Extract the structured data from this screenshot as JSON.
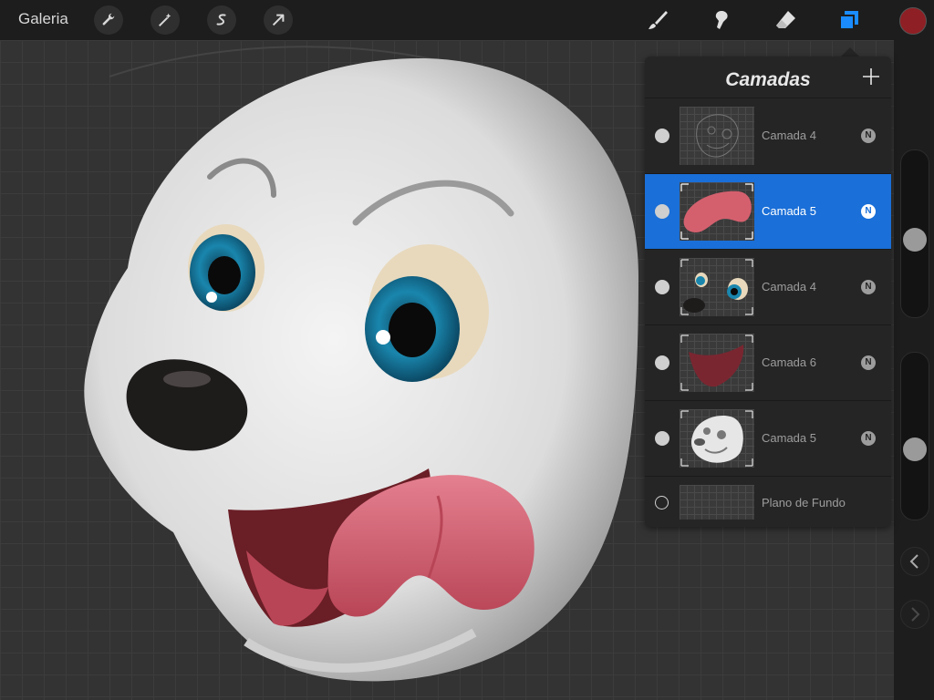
{
  "topbar": {
    "gallery_label": "Galeria",
    "left_tools": [
      "wrench-icon",
      "magic-wand-icon",
      "selection-icon",
      "transform-arrow-icon"
    ],
    "right_tools": [
      "brush-icon",
      "smudge-icon",
      "eraser-icon",
      "layers-icon"
    ],
    "active_tool": "layers-icon",
    "current_color": "#8e1f24"
  },
  "layers_panel": {
    "title": "Camadas",
    "add_icon": "plus-icon",
    "layers": [
      {
        "name": "Camada 4",
        "blend": "N",
        "visible": true,
        "selected": false,
        "thumb": "sketch"
      },
      {
        "name": "Camada 5",
        "blend": "N",
        "visible": true,
        "selected": true,
        "thumb": "tongue"
      },
      {
        "name": "Camada 4",
        "blend": "N",
        "visible": true,
        "selected": false,
        "thumb": "eyes"
      },
      {
        "name": "Camada 6",
        "blend": "N",
        "visible": true,
        "selected": false,
        "thumb": "mouth"
      },
      {
        "name": "Camada 5",
        "blend": "N",
        "visible": true,
        "selected": false,
        "thumb": "head"
      }
    ],
    "background": {
      "name": "Plano de Fundo",
      "visible": false
    }
  },
  "sidebar": {
    "brush_size_level": 0.45,
    "opacity_level": 0.4,
    "undo_icon": "chevron-left-icon",
    "redo_icon": "chevron-right-icon"
  },
  "colors": {
    "accent": "#1a6fd8",
    "tongue": "#d4606e",
    "eye": "#1a7fa6"
  }
}
